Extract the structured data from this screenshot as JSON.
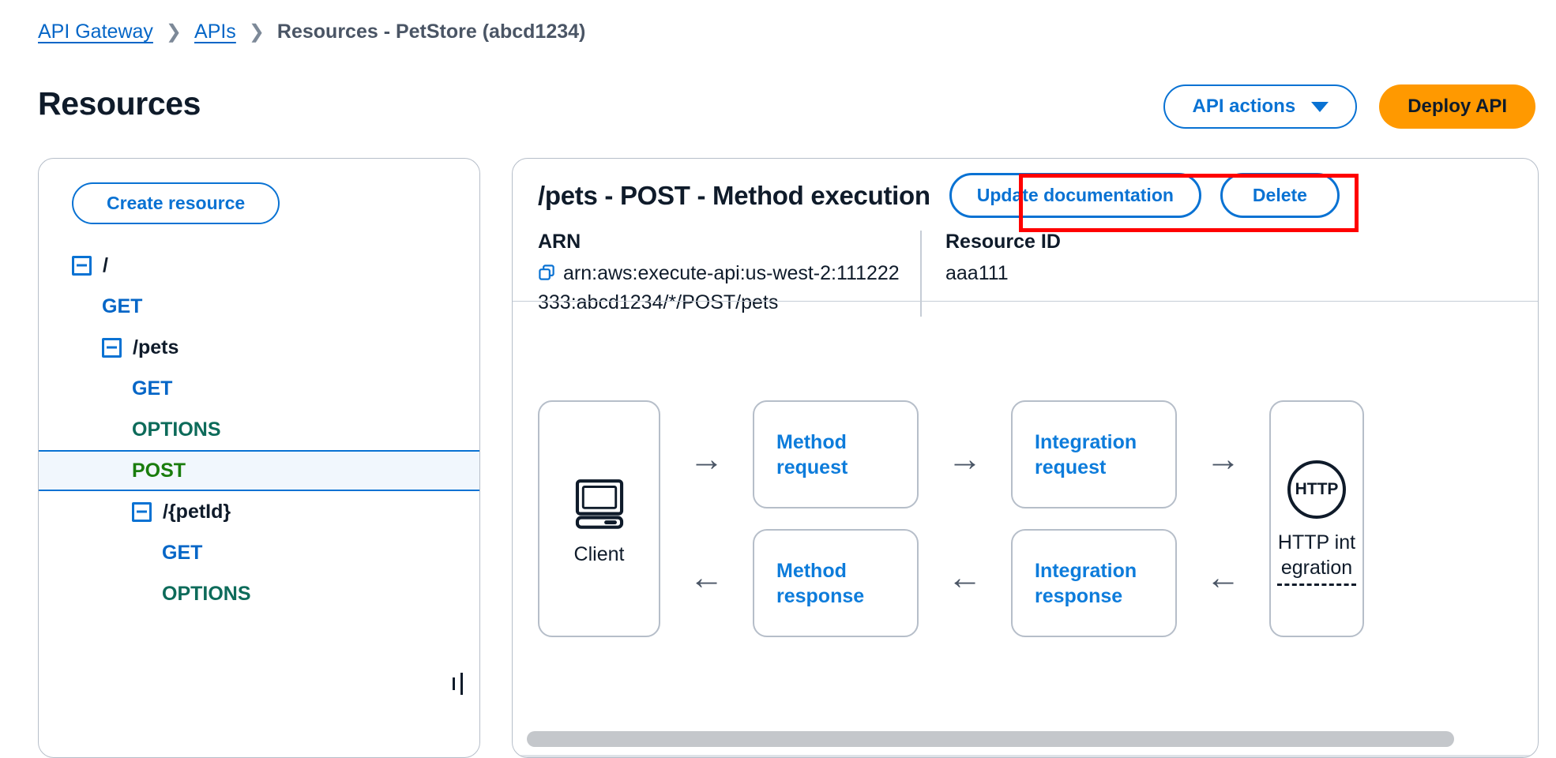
{
  "breadcrumb": {
    "items": [
      {
        "label": "API Gateway",
        "type": "link"
      },
      {
        "label": "APIs",
        "type": "link"
      },
      {
        "label": "Resources - PetStore (abcd1234)",
        "type": "current"
      }
    ],
    "separator": "❯"
  },
  "header": {
    "title": "Resources",
    "api_actions_label": "API actions",
    "deploy_label": "Deploy API",
    "accent_blue": "#0972d3",
    "accent_orange": "#ff9900"
  },
  "sidebar": {
    "create_resource_label": "Create resource",
    "tree": [
      {
        "label": "/",
        "kind": "path",
        "indent": 0,
        "toggle": true,
        "selected": false
      },
      {
        "label": "GET",
        "kind": "get",
        "indent": 1,
        "toggle": false,
        "selected": false
      },
      {
        "label": "/pets",
        "kind": "path",
        "indent": 1,
        "toggle": true,
        "selected": false
      },
      {
        "label": "GET",
        "kind": "get",
        "indent": 2,
        "toggle": false,
        "selected": false
      },
      {
        "label": "OPTIONS",
        "kind": "options",
        "indent": 2,
        "toggle": false,
        "selected": false
      },
      {
        "label": "POST",
        "kind": "post",
        "indent": 2,
        "toggle": false,
        "selected": true
      },
      {
        "label": "/{petId}",
        "kind": "path",
        "indent": 2,
        "toggle": true,
        "selected": false
      },
      {
        "label": "GET",
        "kind": "get",
        "indent": 3,
        "toggle": false,
        "selected": false
      },
      {
        "label": "OPTIONS",
        "kind": "options",
        "indent": 3,
        "toggle": false,
        "selected": false
      }
    ],
    "colors": {
      "get": "#0566c7",
      "options": "#0d6b5a",
      "post": "#1a7d0d",
      "selected_bg": "#f1f7fd"
    }
  },
  "main": {
    "title": "/pets - POST - Method execution",
    "update_documentation_label": "Update documentation",
    "delete_label": "Delete",
    "highlight_color": "#ff0000",
    "arn_label": "ARN",
    "arn_value": "arn:aws:execute-api:us-west-2:111222333:abcd1234/*/POST/pets",
    "resource_id_label": "Resource ID",
    "resource_id_value": "aaa111",
    "copy_icon": "copy-icon"
  },
  "flow": {
    "client_label": "Client",
    "client_icon": "desktop-computer-icon",
    "arrow_right": "→",
    "arrow_left": "←",
    "method_request": "Method request",
    "method_response": "Method response",
    "integration_request": "Integration request",
    "integration_response": "Integration response",
    "http_badge": "HTTP",
    "http_integration_label": "HTTP integration"
  },
  "scrollbar": {
    "orientation": "horizontal",
    "thumb_color": "#c4c7cb"
  }
}
